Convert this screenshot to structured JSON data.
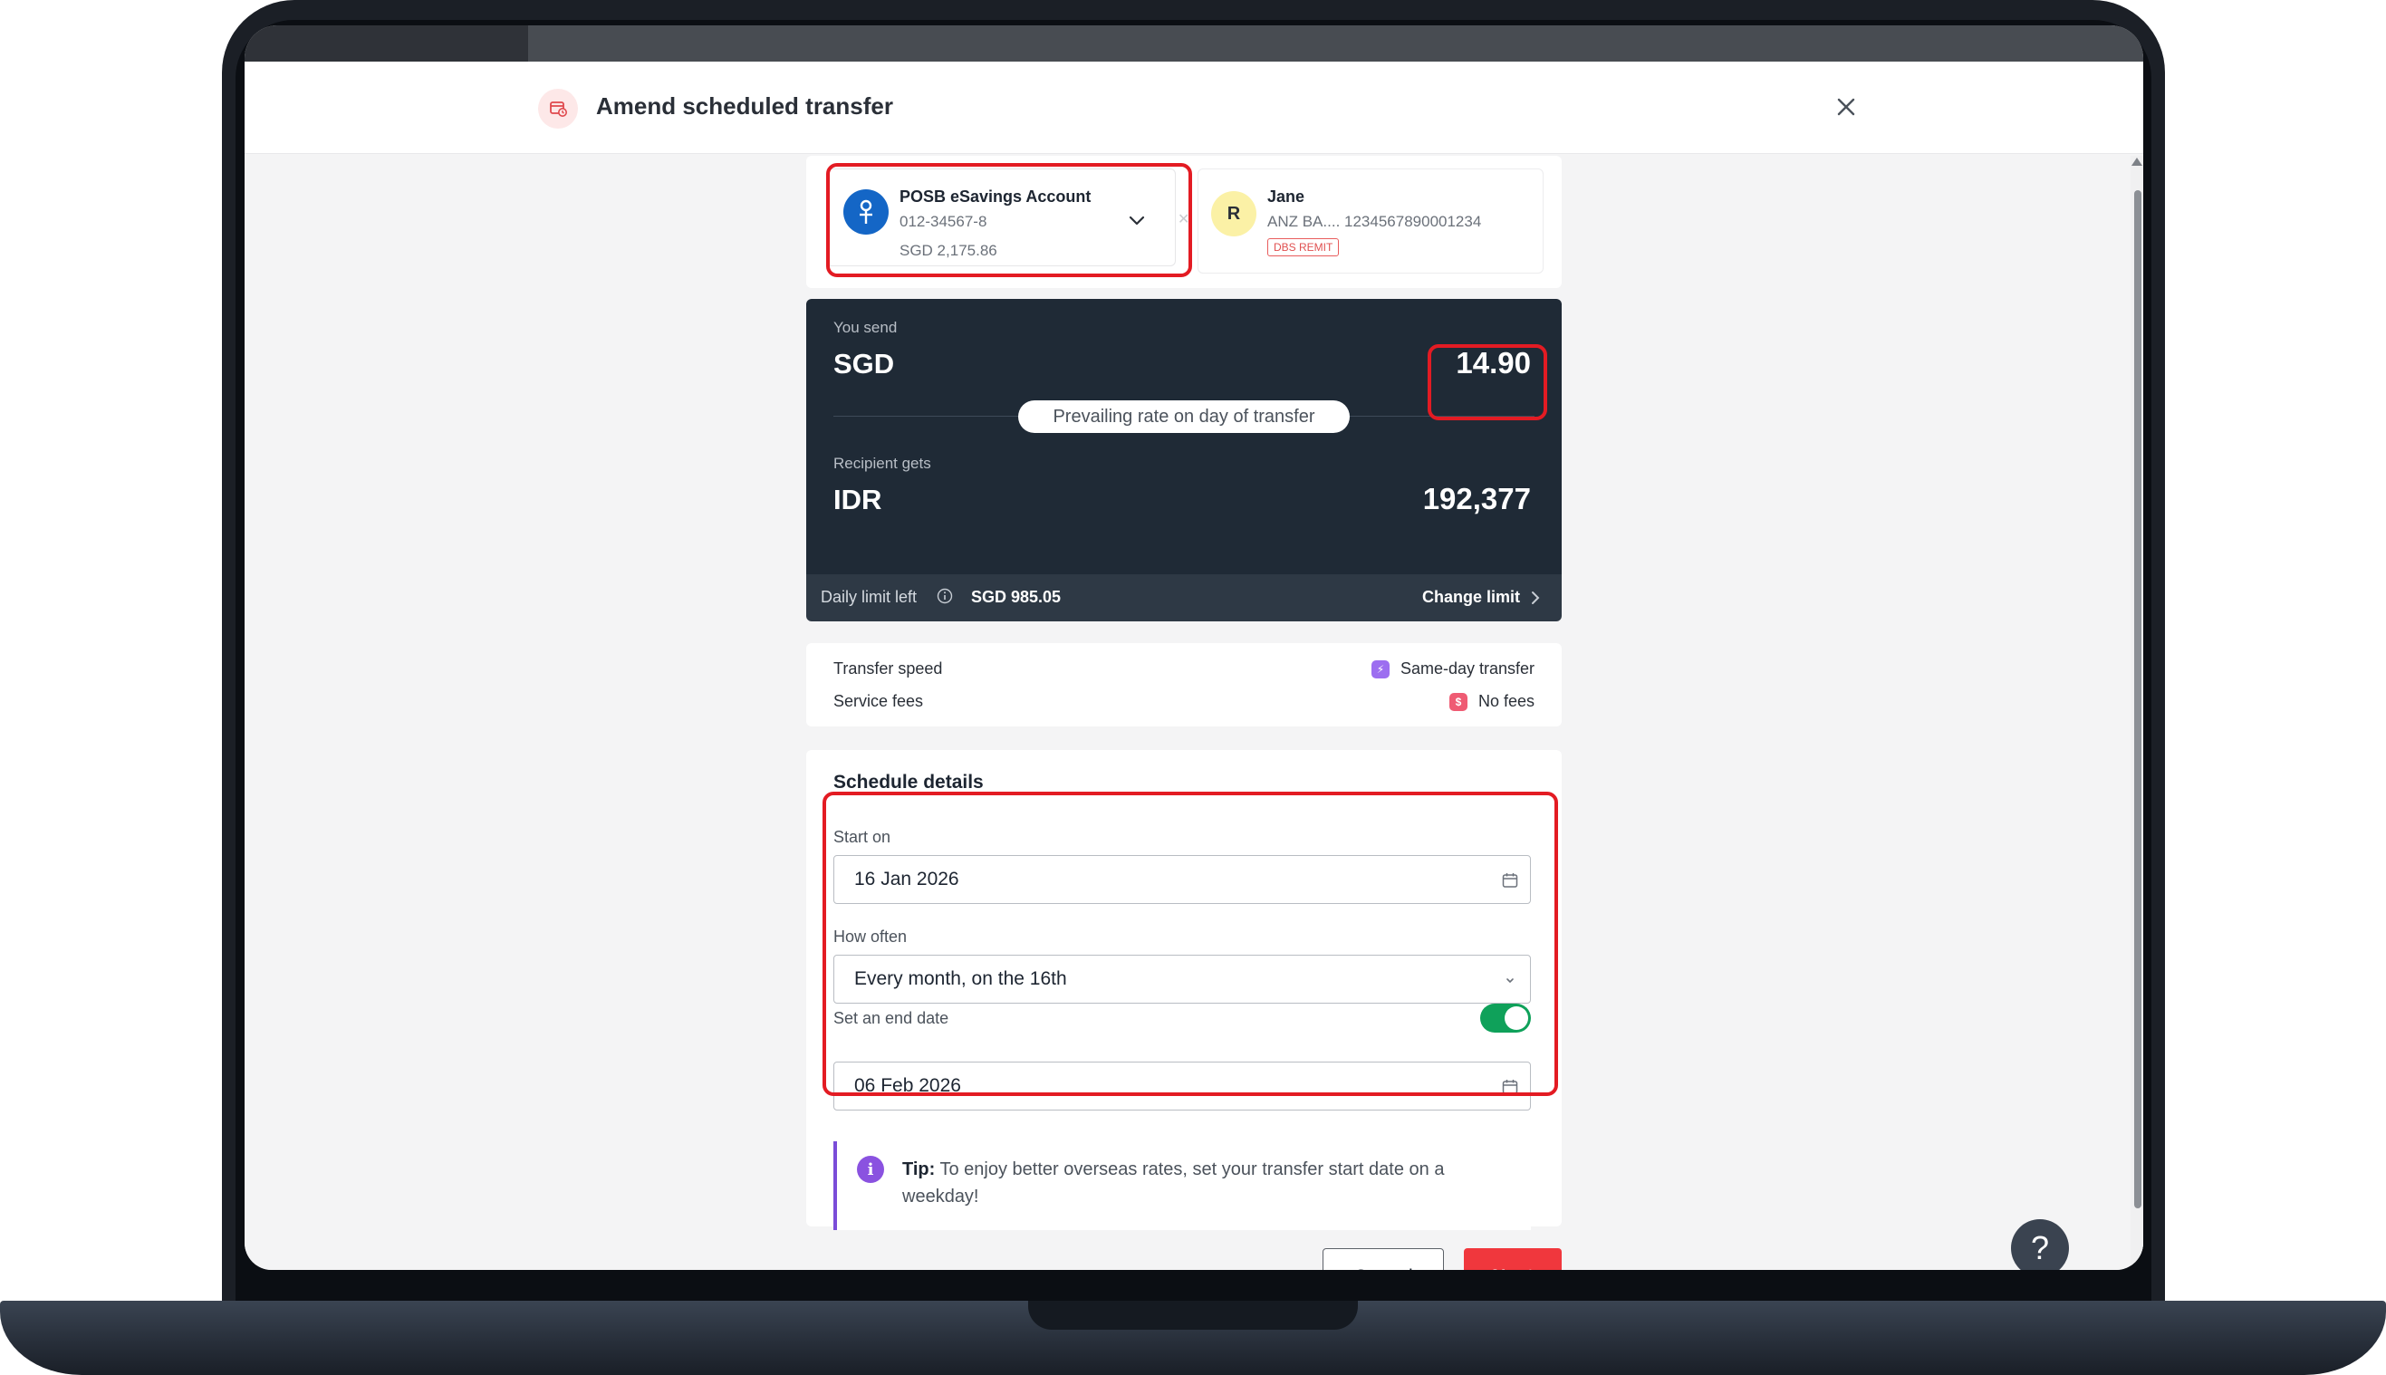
{
  "modal": {
    "title": "Amend scheduled transfer"
  },
  "from_account": {
    "name": "POSB eSavings Account",
    "number": "012-34567-8",
    "balance": "SGD 2,175.86"
  },
  "recipient": {
    "avatar_letter": "R",
    "name": "Jane",
    "bank": "ANZ BA.... 1234567890001234",
    "badge": "DBS REMIT"
  },
  "amount": {
    "send_label": "You send",
    "send_currency": "SGD",
    "send_amount": "14.90",
    "rate_text": "Prevailing rate on day of transfer",
    "receive_label": "Recipient gets",
    "receive_currency": "IDR",
    "receive_amount": "192,377"
  },
  "limit": {
    "label": "Daily limit left",
    "value": "SGD 985.05",
    "link": "Change limit"
  },
  "transfer_info": {
    "speed_label": "Transfer speed",
    "speed_value": "Same-day transfer",
    "fees_label": "Service fees",
    "fees_value": "No fees"
  },
  "schedule": {
    "title": "Schedule details",
    "start_label": "Start on",
    "start_value": "16 Jan 2026",
    "frequency_label": "How often",
    "frequency_value": "Every month, on the 16th",
    "end_toggle_label": "Set an end date",
    "end_toggle_on": true,
    "end_value": "06 Feb 2026"
  },
  "tip": {
    "prefix": "Tip:",
    "text": " To enjoy better overseas rates, set your transfer start date on a weekday!"
  },
  "actions": {
    "cancel": "Cancel",
    "next": "Next"
  },
  "help": {
    "label": "?"
  },
  "colors": {
    "brand_red": "#f0373d",
    "highlight_red": "#e31b23",
    "dark_panel": "#1f2a36",
    "toggle_green": "#0fa15a",
    "tip_purple": "#7a4cd8"
  }
}
